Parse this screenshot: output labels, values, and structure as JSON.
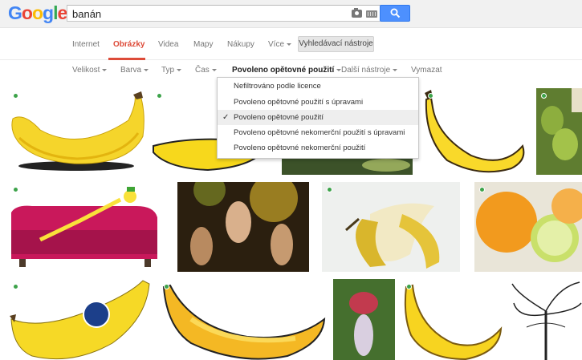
{
  "header": {
    "logo_letters": [
      {
        "ch": "G",
        "color": "#4285f4"
      },
      {
        "ch": "o",
        "color": "#ea4335"
      },
      {
        "ch": "o",
        "color": "#fbbc05"
      },
      {
        "ch": "g",
        "color": "#4285f4"
      },
      {
        "ch": "l",
        "color": "#34a853"
      },
      {
        "ch": "e",
        "color": "#ea4335"
      }
    ],
    "search_value": "banán",
    "camera_icon": "camera-icon",
    "keyboard_icon": "keyboard-icon",
    "search_icon": "search-icon"
  },
  "nav": {
    "tabs": [
      "Internet",
      "Obrázky",
      "Videa",
      "Mapy",
      "Nákupy",
      "Více"
    ],
    "active_tab": "Obrázky",
    "tools_button": "Vyhledávací nástroje"
  },
  "toolbar": {
    "items": [
      "Velikost",
      "Barva",
      "Typ",
      "Čas",
      "Povoleno opětovné použití",
      "Další nástroje"
    ],
    "clear_label": "Vymazat"
  },
  "dropdown": {
    "items": [
      "Nefiltrováno podle licence",
      "Povoleno opětovné použití s úpravami",
      "Povoleno opětovné použití",
      "Povoleno opětovné nekomerční použití s úpravami",
      "Povoleno opětovné nekomerční použití"
    ],
    "selected_index": 2
  },
  "colors": {
    "accent_red": "#dd4b39",
    "search_blue": "#4d90fe",
    "reuse_dot": "#3da34a"
  }
}
